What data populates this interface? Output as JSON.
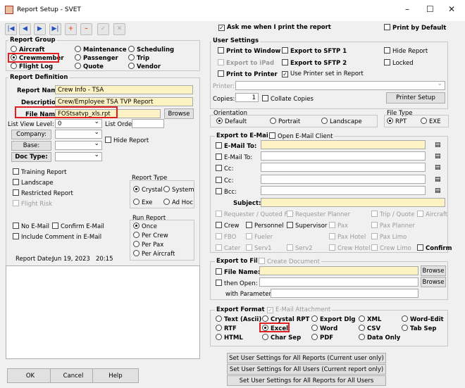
{
  "window": {
    "title": "Report Setup - SVET",
    "minimize": "–",
    "maximize": "☐",
    "close": "✕"
  },
  "toolbar": {
    "first": "|◀",
    "prev": "◀",
    "next": "▶",
    "last": "▶|",
    "add": "+",
    "remove": "–",
    "confirm": "✓",
    "cancel": "✕"
  },
  "report_group": {
    "label": "Report Group",
    "options": [
      "Aircraft",
      "Crewmember",
      "Flight Log",
      "Maintenance",
      "Passenger",
      "Quote",
      "Scheduling",
      "Trip",
      "Vendor"
    ],
    "selected": "Crewmember"
  },
  "report_definition": {
    "label": "Report Definition",
    "report_name_label": "Report Name:",
    "report_name": "Crew Info - TSA",
    "description_label": "Description:",
    "description": "Crew/Employee TSA TVP Report",
    "file_name_label": "File Name:",
    "file_name": "FOStsatvp_xls.rpt",
    "browse": "Browse",
    "list_view_level_label": "List View Level:",
    "list_view_level": "0",
    "list_order_label": "List Order:",
    "company_label": "Company:",
    "base_label": "Base:",
    "doc_type_label": "Doc Type:",
    "hide_report": "Hide Report"
  },
  "left_checks": {
    "training_report": "Training Report",
    "landscape": "Landscape",
    "restricted_report": "Restricted Report",
    "flight_risk": "Flight Risk",
    "no_email": "No E-Mail",
    "confirm_email": "Confirm E-Mail",
    "include_comment": "Include Comment in E-Mail"
  },
  "report_type": {
    "label": "Report Type",
    "options": [
      "Crystal",
      "System",
      "Exe",
      "Ad Hoc"
    ],
    "selected": "Crystal"
  },
  "run_report": {
    "label": "Run Report",
    "options": [
      "Once",
      "Per Crew",
      "Per Pax",
      "Per Aircraft"
    ],
    "selected": "Once"
  },
  "report_date": {
    "label": "Report Date:",
    "date": "Jun 19, 2023",
    "time": "20:15"
  },
  "bottom_buttons": {
    "ok": "OK",
    "cancel": "Cancel",
    "help": "Help"
  },
  "top_checks": {
    "ask": "Ask me when I print the report",
    "print_default": "Print by Default"
  },
  "user_settings": {
    "label": "User Settings",
    "print_window": "Print to Window",
    "export_sftp1": "Export to SFTP 1",
    "hide_report": "Hide Report",
    "export_ipad": "Export to iPad",
    "export_sftp2": "Export to SFTP 2",
    "locked": "Locked",
    "print_printer": "Print to Printer",
    "use_printer": "Use Printer set in Report",
    "printer_label": "Printer:",
    "copies_label": "Copies:",
    "copies": "1",
    "collate": "Collate Copies",
    "printer_setup": "Printer Setup"
  },
  "orientation": {
    "label": "Orientation",
    "options": [
      "Default",
      "Portrait",
      "Landscape"
    ],
    "selected": "Default"
  },
  "file_type": {
    "label": "File Type",
    "options": [
      "RPT",
      "EXE"
    ],
    "selected": "RPT"
  },
  "export_email": {
    "label": "Export to E-Mail",
    "open_client": "Open E-Mail Client",
    "email_to_bold": "E-Mail To:",
    "email_to": "E-Mail To:",
    "cc": "Cc:",
    "bcc": "Bcc:",
    "subject": "Subject:",
    "recips": [
      "Requester / Quoted For",
      "Requester Planner",
      "Trip / Quote",
      "Aircraft",
      "Crew",
      "Personnel",
      "Supervisor",
      "Pax",
      "Pax Planner",
      "FBO",
      "Fueler",
      "Pax Hotel",
      "Pax Limo",
      "Cater",
      "Serv1",
      "Serv2",
      "Crew Hotel",
      "Crew Limo",
      "Confirm"
    ]
  },
  "export_file": {
    "label": "Export to File",
    "create_doc": "Create Document",
    "file_name": "File Name:",
    "then_open": "then Open:",
    "with_params": "with Parameters:",
    "browse": "Browse"
  },
  "export_format": {
    "label": "Export Format",
    "email_attachment": "E-Mail Attachment",
    "options": [
      "Text (Ascii)",
      "Crystal RPT",
      "Export Dlg",
      "XML",
      "Word-Edit",
      "RTF",
      "Excel",
      "Word",
      "CSV",
      "Tab Sep",
      "HTML",
      "Char Sep",
      "PDF",
      "Data Only"
    ],
    "selected": "Excel"
  },
  "set_buttons": [
    "Set User Settings for All Reports (Current user only)",
    "Set User Settings for All Users (Current report only)",
    "Set User Settings for All Reports for All Users"
  ]
}
